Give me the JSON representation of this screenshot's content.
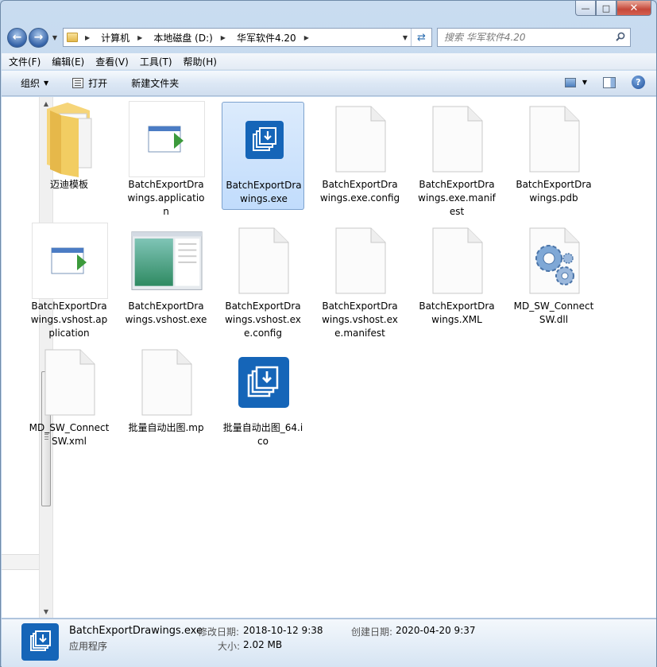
{
  "window": {
    "caption": {
      "minimize": "—",
      "maximize": "□",
      "close": "✕"
    }
  },
  "address": {
    "crumbs": [
      "计算机",
      "本地磁盘 (D:)",
      "华军软件4.20"
    ],
    "search_placeholder": "搜索 华军软件4.20"
  },
  "menu": [
    "文件(F)",
    "编辑(E)",
    "查看(V)",
    "工具(T)",
    "帮助(H)"
  ],
  "toolbar": {
    "organize": "组织",
    "open": "打开",
    "new_folder": "新建文件夹"
  },
  "files": [
    {
      "name": "迈迪模板",
      "icon": "folder-icon"
    },
    {
      "name": "BatchExportDrawings.application",
      "icon": "application-icon"
    },
    {
      "name": "BatchExportDrawings.exe",
      "icon": "app-exe-icon",
      "selected": true
    },
    {
      "name": "BatchExportDrawings.exe.config",
      "icon": "blank-file-icon"
    },
    {
      "name": "BatchExportDrawings.exe.manifest",
      "icon": "blank-file-icon"
    },
    {
      "name": "BatchExportDrawings.pdb",
      "icon": "blank-file-icon"
    },
    {
      "name": "BatchExportDrawings.vshost.application",
      "icon": "application-icon"
    },
    {
      "name": "BatchExportDrawings.vshost.exe",
      "icon": "window-preview-icon"
    },
    {
      "name": "BatchExportDrawings.vshost.exe.config",
      "icon": "blank-file-icon"
    },
    {
      "name": "BatchExportDrawings.vshost.exe.manifest",
      "icon": "blank-file-icon"
    },
    {
      "name": "BatchExportDrawings.XML",
      "icon": "blank-file-icon"
    },
    {
      "name": "MD_SW_ConnectSW.dll",
      "icon": "dll-gear-icon"
    },
    {
      "name": "MD_SW_ConnectSW.xml",
      "icon": "blank-file-icon"
    },
    {
      "name": "批量自动出图.mp",
      "icon": "blank-file-icon"
    },
    {
      "name": "批量自动出图_64.ico",
      "icon": "app-ico-icon"
    }
  ],
  "details": {
    "name": "BatchExportDrawings.exe",
    "type": "应用程序",
    "modified_label": "修改日期:",
    "modified": "2018-10-12 9:38",
    "size_label": "大小:",
    "size": "2.02 MB",
    "created_label": "创建日期:",
    "created": "2020-04-20 9:37"
  },
  "colors": {
    "selection": "#c1dcfc",
    "app_blue": "#1565b8",
    "frame": "#b4cbe6"
  }
}
